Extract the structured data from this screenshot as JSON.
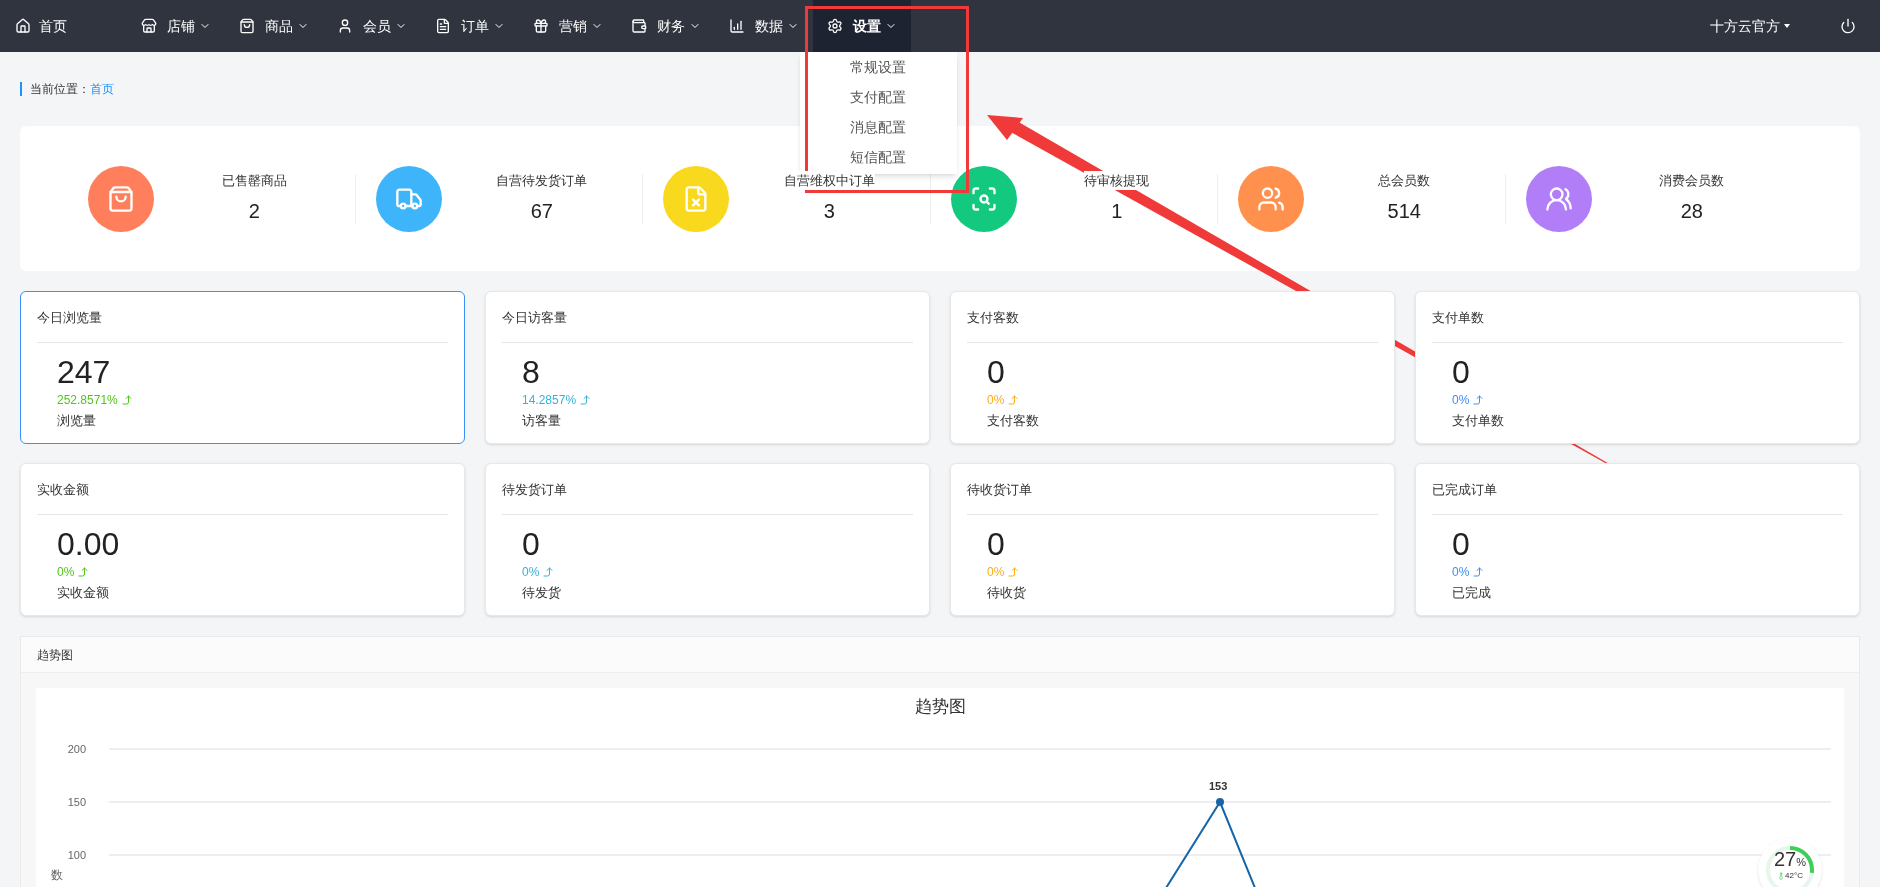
{
  "nav": {
    "home": {
      "label": "首页",
      "kind": "home"
    },
    "items": [
      {
        "label": "店铺",
        "kind": "store",
        "selected": false
      },
      {
        "label": "商品",
        "kind": "bag",
        "selected": false
      },
      {
        "label": "会员",
        "kind": "user",
        "selected": false
      },
      {
        "label": "订单",
        "kind": "file",
        "selected": false
      },
      {
        "label": "营销",
        "kind": "gift",
        "selected": false
      },
      {
        "label": "财务",
        "kind": "wallet",
        "selected": false
      },
      {
        "label": "数据",
        "kind": "chart",
        "selected": false
      },
      {
        "label": "设置",
        "kind": "gear",
        "selected": true
      }
    ],
    "user": "十方云官方",
    "dropdown": [
      "常规设置",
      "支付配置",
      "消息配置",
      "短信配置"
    ]
  },
  "breadcrumb": {
    "label": "当前位置：",
    "link": "首页"
  },
  "stats": [
    {
      "label": "已售罄商品",
      "value": "2",
      "kind": "bag",
      "color": "#ff7f5c"
    },
    {
      "label": "自营待发货订单",
      "value": "67",
      "kind": "truck",
      "color": "#3eb4fb"
    },
    {
      "label": "自营维权中订单",
      "value": "3",
      "kind": "doc-x",
      "color": "#f8d91e"
    },
    {
      "label": "待审核提现",
      "value": "1",
      "kind": "scan",
      "color": "#13c97f"
    },
    {
      "label": "总会员数",
      "value": "514",
      "kind": "users",
      "color": "#ff904d"
    },
    {
      "label": "消费会员数",
      "value": "28",
      "kind": "users-solid",
      "color": "#b17ef8"
    }
  ],
  "cards": [
    {
      "title": "今日浏览量",
      "value": "247",
      "change": "252.8571%",
      "caption": "浏览量",
      "color": "#52c41a",
      "selected": true
    },
    {
      "title": "今日访客量",
      "value": "8",
      "change": "14.2857%",
      "caption": "访客量",
      "color": "#36b3d6",
      "selected": false
    },
    {
      "title": "支付客数",
      "value": "0",
      "change": "0%",
      "caption": "支付客数",
      "color": "#faad14",
      "selected": false
    },
    {
      "title": "支付单数",
      "value": "0",
      "change": "0%",
      "caption": "支付单数",
      "color": "#3b8ff6",
      "selected": false
    },
    {
      "title": "实收金额",
      "value": "0.00",
      "change": "0%",
      "caption": "实收金额",
      "color": "#52c41a",
      "selected": false
    },
    {
      "title": "待发货订单",
      "value": "0",
      "change": "0%",
      "caption": "待发货",
      "color": "#36b3d6",
      "selected": false
    },
    {
      "title": "待收货订单",
      "value": "0",
      "change": "0%",
      "caption": "待收货",
      "color": "#faad14",
      "selected": false
    },
    {
      "title": "已完成订单",
      "value": "0",
      "change": "0%",
      "caption": "已完成",
      "color": "#3b8ff6",
      "selected": false
    }
  ],
  "trend": {
    "header": "趋势图",
    "chart": {
      "title": "趋势图",
      "yticks": [
        "200",
        "150",
        "100"
      ],
      "ylabel": "数",
      "point_label": "153"
    }
  },
  "monitor": {
    "percent": "27",
    "unit": "%",
    "temp": "42°C",
    "level": 0.27
  }
}
